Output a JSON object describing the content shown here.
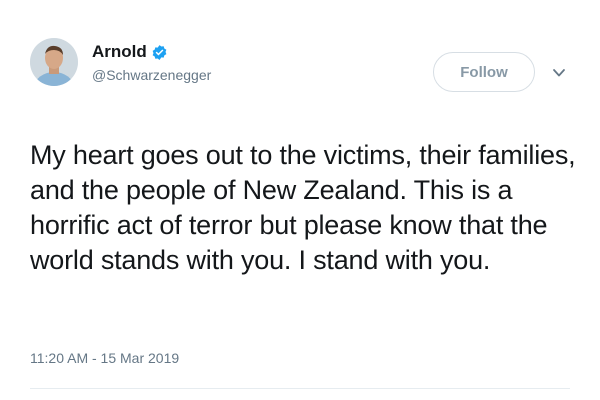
{
  "author": {
    "name": "Arnold",
    "handle": "@Schwarzenegger",
    "verified": true,
    "verified_color": "#1da1f2"
  },
  "follow_button": {
    "label": "Follow"
  },
  "more_menu": {
    "icon": "chevron-down-icon"
  },
  "tweet": {
    "text": "My heart goes out to the victims, their families, and the people of New Zealand. This is a horrific act of terror but please know that the world stands with you. I stand with you.",
    "timestamp": "11:20 AM - 15 Mar 2019"
  },
  "colors": {
    "text": "#14171a",
    "secondary": "#657786",
    "follow_border": "#d7dee4",
    "follow_text": "#8899a6"
  }
}
